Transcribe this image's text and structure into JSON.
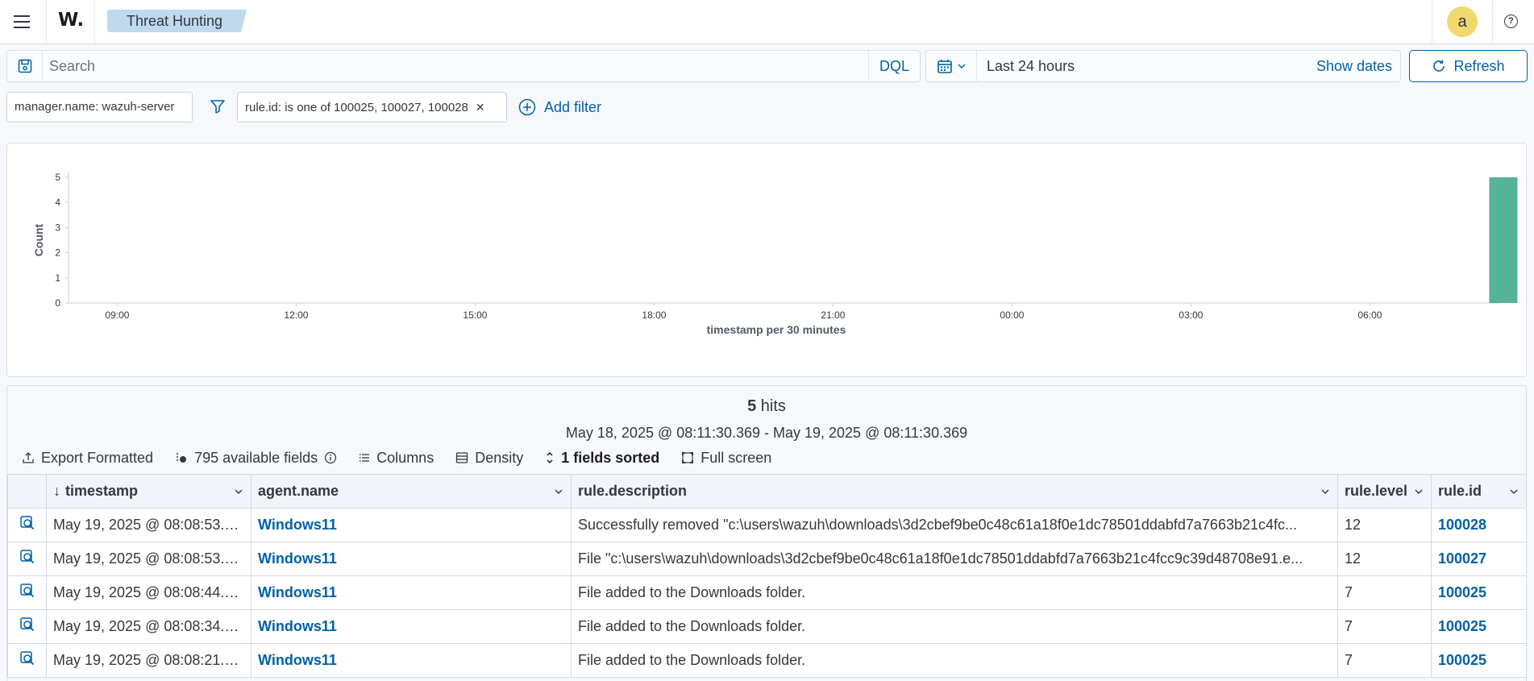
{
  "header": {
    "logo": "W.",
    "breadcrumb": "Threat Hunting",
    "avatar_letter": "a",
    "help_glyph": "?"
  },
  "query": {
    "placeholder": "Search",
    "language": "DQL",
    "time_range": "Last 24 hours",
    "show_dates": "Show dates",
    "refresh": "Refresh"
  },
  "filters": {
    "pinned": "manager.name: wazuh-server",
    "rule_filter": "rule.id: is one of 100025, 100027, 100028",
    "add_filter": "Add filter"
  },
  "chart_data": {
    "type": "bar",
    "xlabel": "timestamp per 30 minutes",
    "ylabel": "Count",
    "ylim": [
      0,
      5
    ],
    "yticks": [
      0,
      1,
      2,
      3,
      4,
      5
    ],
    "x_tick_labels": [
      "09:00",
      "12:00",
      "15:00",
      "18:00",
      "21:00",
      "00:00",
      "03:00",
      "06:00"
    ],
    "x_start": "08:11",
    "x_end": "08:11 (+1 day)",
    "bars": [
      {
        "bucket": "08:00",
        "value": 5
      }
    ],
    "bar_color": "#54b399",
    "grid": false
  },
  "results": {
    "hits_count": "5",
    "hits_label": " hits",
    "range": "May 18, 2025 @ 08:11:30.369 - May 19, 2025 @ 08:11:30.369",
    "toolbar": {
      "export": "Export Formatted",
      "fields": "795 available fields",
      "columns": "Columns",
      "density": "Density",
      "sorted": "1 fields sorted",
      "fullscreen": "Full screen"
    },
    "columns": [
      "timestamp",
      "agent.name",
      "rule.description",
      "rule.level",
      "rule.id"
    ],
    "rows": [
      {
        "timestamp": "May 19, 2025 @ 08:08:53.6...",
        "agent": "Windows11",
        "description": "Successfully removed \"c:\\users\\wazuh\\downloads\\3d2cbef9be0c48c61a18f0e1dc78501ddabfd7a7663b21c4fc...",
        "level": "12",
        "id": "100028"
      },
      {
        "timestamp": "May 19, 2025 @ 08:08:53.6...",
        "agent": "Windows11",
        "description": "File \"c:\\users\\wazuh\\downloads\\3d2cbef9be0c48c61a18f0e1dc78501ddabfd7a7663b21c4fcc9c39d48708e91.e...",
        "level": "12",
        "id": "100027"
      },
      {
        "timestamp": "May 19, 2025 @ 08:08:44.9...",
        "agent": "Windows11",
        "description": "File added to the Downloads folder.",
        "level": "7",
        "id": "100025"
      },
      {
        "timestamp": "May 19, 2025 @ 08:08:34.0...",
        "agent": "Windows11",
        "description": "File added to the Downloads folder.",
        "level": "7",
        "id": "100025"
      },
      {
        "timestamp": "May 19, 2025 @ 08:08:21.6...",
        "agent": "Windows11",
        "description": "File added to the Downloads folder.",
        "level": "7",
        "id": "100025"
      }
    ]
  }
}
